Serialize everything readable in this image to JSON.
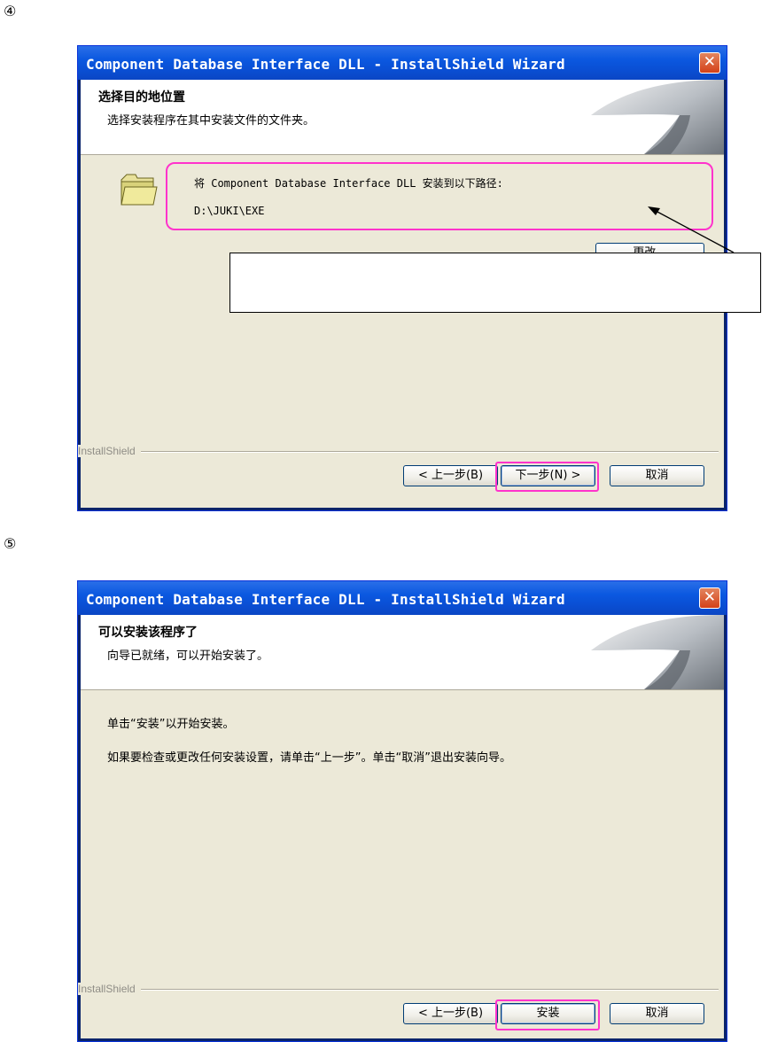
{
  "step4": {
    "number": "④",
    "window_title": "Component Database Interface DLL - InstallShield Wizard",
    "close_glyph": "✕",
    "header_title": "选择目的地位置",
    "header_subtitle": "选择安装程序在其中安装文件的文件夹。",
    "install_to_label": "将 Component Database Interface DLL 安装到以下路径:",
    "install_path": "D:\\JUKI\\EXE",
    "change_button": "更改...",
    "brand": "InstallShield",
    "back_button": "< 上一步(B)",
    "next_button": "下一步(N) >",
    "cancel_button": "取消",
    "callout_text": ""
  },
  "step5": {
    "number": "⑤",
    "window_title": "Component Database Interface DLL - InstallShield Wizard",
    "close_glyph": "✕",
    "header_title": "可以安装该程序了",
    "header_subtitle": "向导已就绪，可以开始安装了。",
    "line1": "单击“安装”以开始安装。",
    "line2": "如果要检查或更改任何安装设置，请单击“上一步”。单击“取消”退出安装向导。",
    "brand": "InstallShield",
    "back_button": "< 上一步(B)",
    "install_button": "安装",
    "cancel_button": "取消"
  },
  "colors": {
    "highlight": "#ff33cc",
    "title_bar": "#0b58e0",
    "dialog_face": "#ece9d8",
    "close_button": "#d44118"
  },
  "icons": [
    "folder-icon",
    "close-icon",
    "header-swoosh-graphic"
  ]
}
